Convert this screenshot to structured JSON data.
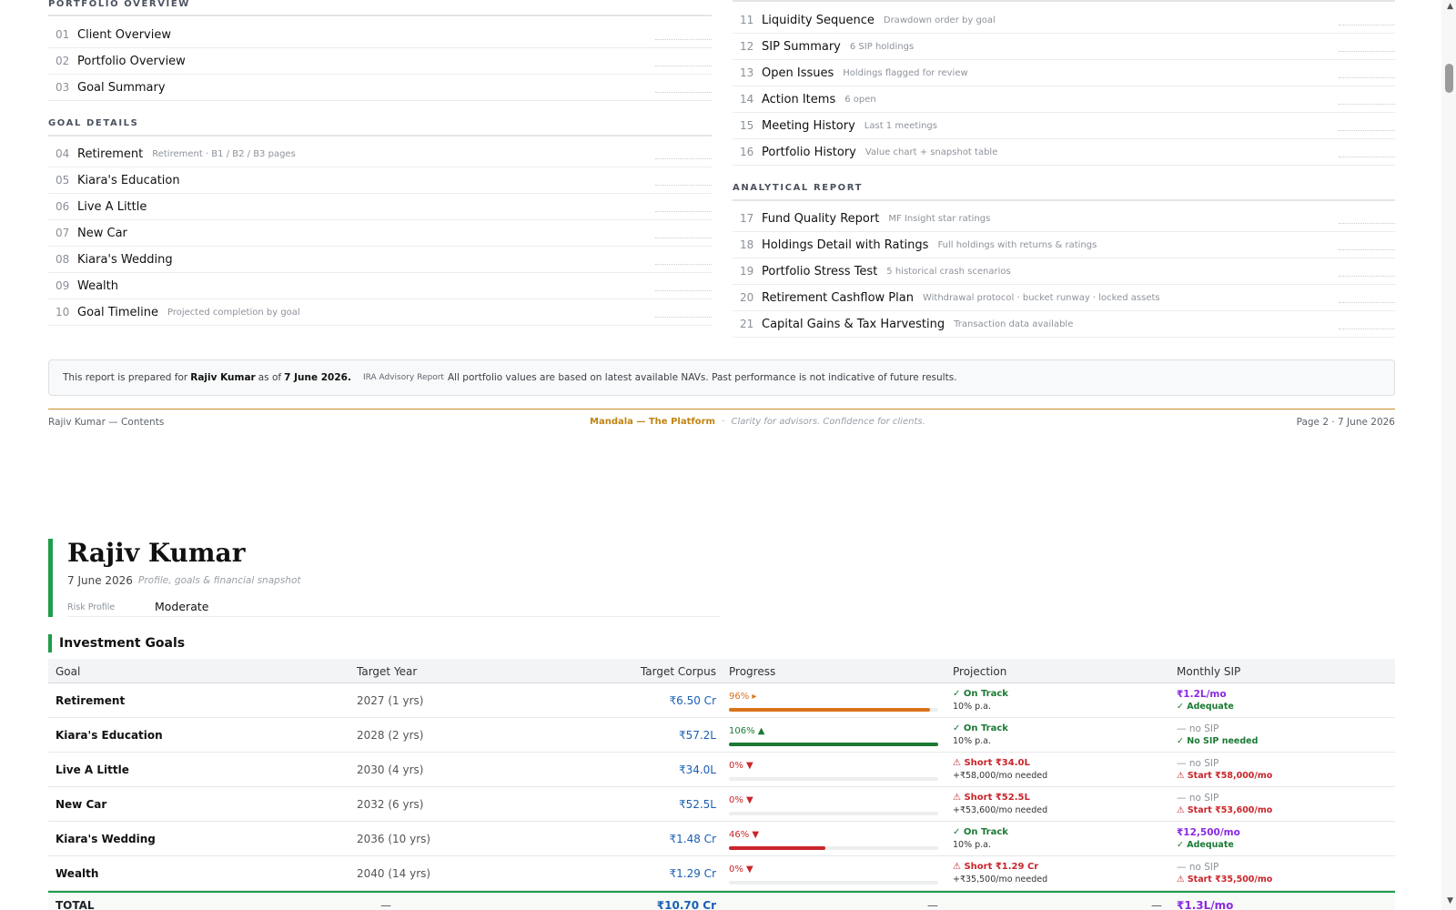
{
  "toc": {
    "portfolio_overview_heading": "PORTFOLIO OVERVIEW",
    "goal_details_heading": "GOAL DETAILS",
    "analytical_report_heading": "ANALYTICAL REPORT",
    "left_top": [
      {
        "num": "01",
        "title": "Client Overview",
        "sub": ""
      },
      {
        "num": "02",
        "title": "Portfolio Overview",
        "sub": ""
      },
      {
        "num": "03",
        "title": "Goal Summary",
        "sub": ""
      }
    ],
    "left_goals": [
      {
        "num": "04",
        "title": "Retirement",
        "sub": "Retirement · B1 / B2 / B3 pages"
      },
      {
        "num": "05",
        "title": "Kiara's Education",
        "sub": ""
      },
      {
        "num": "06",
        "title": "Live A Little",
        "sub": ""
      },
      {
        "num": "07",
        "title": "New Car",
        "sub": ""
      },
      {
        "num": "08",
        "title": "Kiara's Wedding",
        "sub": ""
      },
      {
        "num": "09",
        "title": "Wealth",
        "sub": ""
      },
      {
        "num": "10",
        "title": "Goal Timeline",
        "sub": "Projected completion by goal"
      }
    ],
    "right_top": [
      {
        "num": "11",
        "title": "Liquidity Sequence",
        "sub": "Drawdown order by goal"
      },
      {
        "num": "12",
        "title": "SIP Summary",
        "sub": "6 SIP holdings"
      },
      {
        "num": "13",
        "title": "Open Issues",
        "sub": "Holdings flagged for review"
      },
      {
        "num": "14",
        "title": "Action Items",
        "sub": "6 open"
      },
      {
        "num": "15",
        "title": "Meeting History",
        "sub": "Last 1 meetings"
      },
      {
        "num": "16",
        "title": "Portfolio History",
        "sub": "Value chart + snapshot table"
      }
    ],
    "right_analytical": [
      {
        "num": "17",
        "title": "Fund Quality Report",
        "sub": "MF Insight star ratings"
      },
      {
        "num": "18",
        "title": "Holdings Detail with Ratings",
        "sub": "Full holdings with returns & ratings"
      },
      {
        "num": "19",
        "title": "Portfolio Stress Test",
        "sub": "5 historical crash scenarios"
      },
      {
        "num": "20",
        "title": "Retirement Cashflow Plan",
        "sub": "Withdrawal protocol · bucket runway · locked assets"
      },
      {
        "num": "21",
        "title": "Capital Gains & Tax Harvesting",
        "sub": "Transaction data available"
      }
    ]
  },
  "notice": {
    "prefix": "This report is prepared for",
    "client": "Rajiv Kumar",
    "as_of": "as of",
    "date": "7 June 2026.",
    "tag": "IRA Advisory Report",
    "text": "All portfolio values are based on latest available NAVs. Past performance is not indicative of future results."
  },
  "footer": {
    "left": "Rajiv Kumar — Contents",
    "brand": "Mandala — The Platform",
    "separator": "·",
    "tagline": "Clarity for advisors. Confidence for clients.",
    "right": "Page 2  ·  7 June 2026"
  },
  "profile": {
    "name": "Rajiv Kumar",
    "date": "7 June 2026",
    "subtitle": "Profile, goals & financial snapshot",
    "risk_label": "Risk Profile",
    "risk_value": "Moderate"
  },
  "goals": {
    "title": "Investment Goals",
    "headers": {
      "goal": "Goal",
      "target_year": "Target Year",
      "target_corpus": "Target Corpus",
      "progress": "Progress",
      "projection": "Projection",
      "monthly_sip": "Monthly SIP"
    },
    "rows": [
      {
        "goal": "Retirement",
        "year": "2027 (1 yrs)",
        "corpus": "₹6.50 Cr",
        "progress_label": "96% ▸",
        "progress": 96,
        "progress_status": "near",
        "proj_main": "✓ On Track",
        "proj_sub": "10% p.a.",
        "proj_status": "ok",
        "sip_main": "₹1.2L/mo",
        "sip_main_status": "amount",
        "sip_sub": "✓ Adequate",
        "sip_sub_status": "ok"
      },
      {
        "goal": "Kiara's Education",
        "year": "2028 (2 yrs)",
        "corpus": "₹57.2L",
        "progress_label": "106% ▲",
        "progress": 106,
        "progress_status": "ok",
        "proj_main": "✓ On Track",
        "proj_sub": "10% p.a.",
        "proj_status": "ok",
        "sip_main": "— no SIP",
        "sip_main_status": "none",
        "sip_sub": "✓ No SIP needed",
        "sip_sub_status": "ok"
      },
      {
        "goal": "Live A Little",
        "year": "2030 (4 yrs)",
        "corpus": "₹34.0L",
        "progress_label": "0% ▼",
        "progress": 0,
        "progress_status": "bad",
        "proj_main": "⚠ Short ₹34.0L",
        "proj_sub": "+₹58,000/mo needed",
        "proj_status": "bad",
        "sip_main": "— no SIP",
        "sip_main_status": "none",
        "sip_sub": "⚠ Start ₹58,000/mo",
        "sip_sub_status": "bad"
      },
      {
        "goal": "New Car",
        "year": "2032 (6 yrs)",
        "corpus": "₹52.5L",
        "progress_label": "0% ▼",
        "progress": 0,
        "progress_status": "bad",
        "proj_main": "⚠ Short ₹52.5L",
        "proj_sub": "+₹53,600/mo needed",
        "proj_status": "bad",
        "sip_main": "— no SIP",
        "sip_main_status": "none",
        "sip_sub": "⚠ Start ₹53,600/mo",
        "sip_sub_status": "bad"
      },
      {
        "goal": "Kiara's Wedding",
        "year": "2036 (10 yrs)",
        "corpus": "₹1.48 Cr",
        "progress_label": "46% ▼",
        "progress": 46,
        "progress_status": "bad",
        "proj_main": "✓ On Track",
        "proj_sub": "10% p.a.",
        "proj_status": "ok",
        "sip_main": "₹12,500/mo",
        "sip_main_status": "amount",
        "sip_sub": "✓ Adequate",
        "sip_sub_status": "ok"
      },
      {
        "goal": "Wealth",
        "year": "2040 (14 yrs)",
        "corpus": "₹1.29 Cr",
        "progress_label": "0% ▼",
        "progress": 0,
        "progress_status": "bad",
        "proj_main": "⚠ Short ₹1.29 Cr",
        "proj_sub": "+₹35,500/mo needed",
        "proj_status": "bad",
        "sip_main": "— no SIP",
        "sip_main_status": "none",
        "sip_sub": "⚠ Start ₹35,500/mo",
        "sip_sub_status": "bad"
      }
    ],
    "total": {
      "label": "TOTAL",
      "year": "—",
      "corpus": "₹10.70 Cr",
      "progress": "—",
      "projection": "—",
      "sip": "₹1.3L/mo"
    }
  },
  "colors": {
    "ok": "#1b7a34",
    "bad": "#c9252b",
    "near": "#d9731a",
    "amount": "#8a2be2",
    "accent_green": "#1f9d4a",
    "brand_gold": "#c08412"
  },
  "icons": {
    "scroll_up": "scroll-up-arrow-icon",
    "scroll_down": "scroll-down-arrow-icon"
  }
}
